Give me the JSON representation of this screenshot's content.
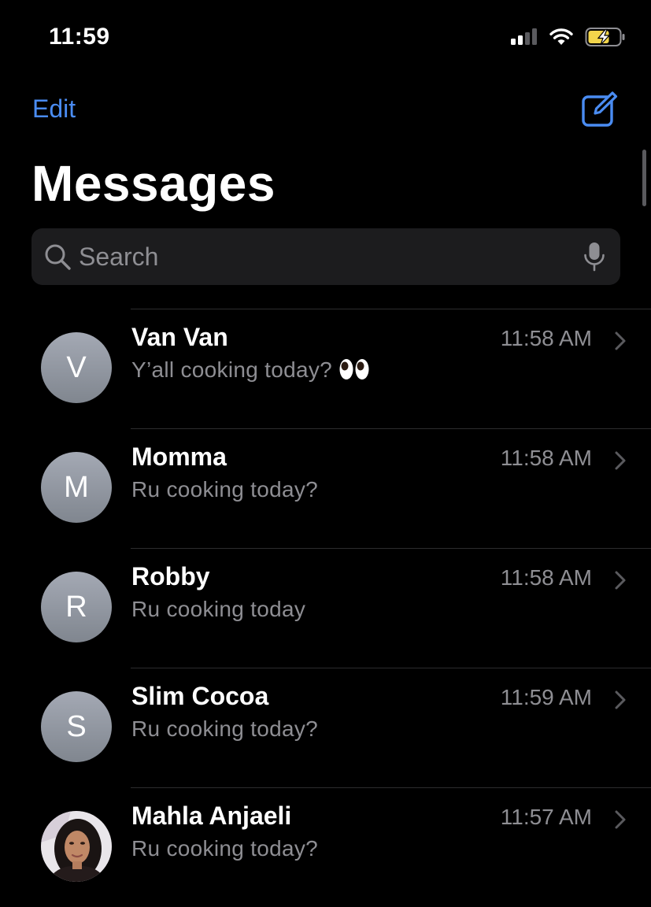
{
  "status_bar": {
    "time": "11:59",
    "icons": [
      "cellular-signal-icon",
      "wifi-icon",
      "battery-charging-icon"
    ]
  },
  "nav": {
    "edit_label": "Edit",
    "compose_icon": "compose-icon"
  },
  "page_title": "Messages",
  "search": {
    "placeholder": "Search",
    "icons": [
      "search-icon",
      "microphone-icon"
    ]
  },
  "conversations": [
    {
      "name": "Van Van",
      "initial": "V",
      "preview": "Y’all cooking today?",
      "time": "11:58 AM",
      "emoji": "eyes"
    },
    {
      "name": "Momma",
      "initial": "M",
      "preview": "Ru cooking today?",
      "time": "11:58 AM"
    },
    {
      "name": "Robby",
      "initial": "R",
      "preview": "Ru cooking today",
      "time": "11:58 AM"
    },
    {
      "name": "Slim Cocoa",
      "initial": "S",
      "preview": "Ru cooking today?",
      "time": "11:59 AM"
    },
    {
      "name": "Mahla Anjaeli",
      "initial": "",
      "preview": "Ru cooking today?",
      "time": "11:57 AM",
      "avatar": "photo"
    }
  ],
  "colors": {
    "background": "#000000",
    "accent": "#4a8cf2",
    "secondary_text": "#8e8e93",
    "search_bg": "#1c1c1e",
    "battery_fill": "#f2d54b"
  }
}
